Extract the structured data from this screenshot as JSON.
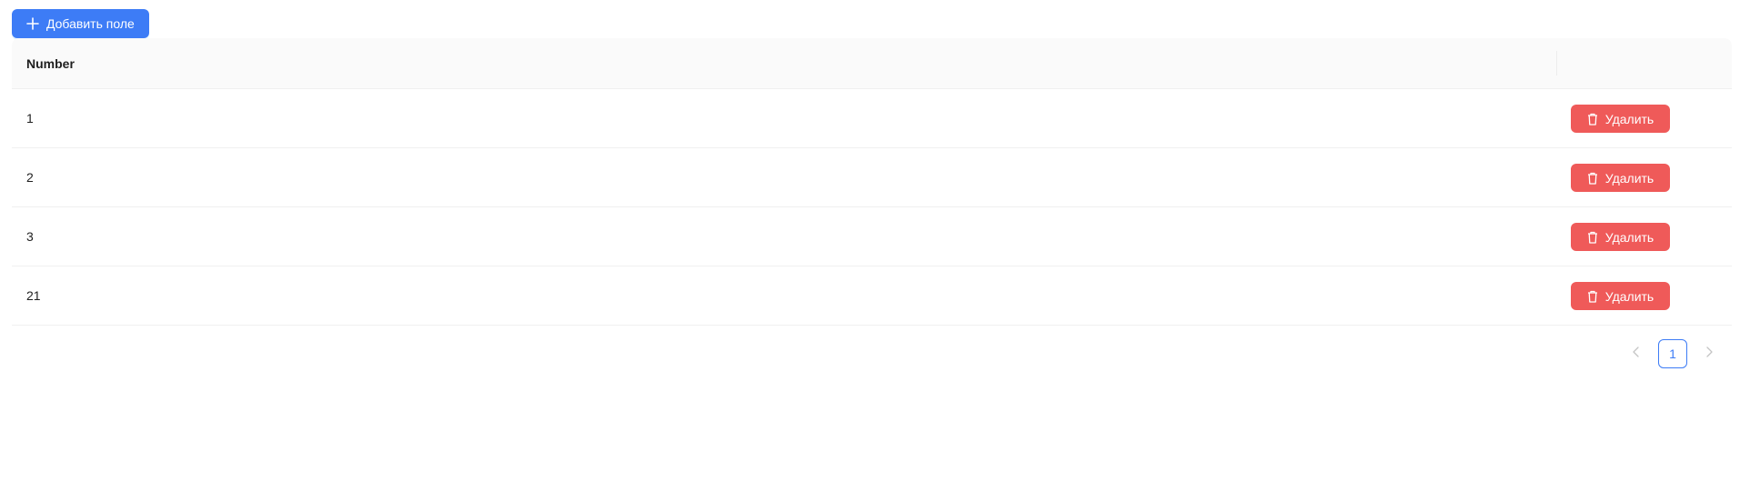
{
  "toolbar": {
    "add_label": "Добавить поле",
    "add_icon": "plus-icon"
  },
  "table": {
    "columns": [
      "Number",
      ""
    ],
    "rows": [
      {
        "number": "1",
        "delete_label": "Удалить"
      },
      {
        "number": "2",
        "delete_label": "Удалить"
      },
      {
        "number": "3",
        "delete_label": "Удалить"
      },
      {
        "number": "21",
        "delete_label": "Удалить"
      }
    ],
    "delete_icon": "trash-icon"
  },
  "pagination": {
    "current_page": "1",
    "prev_icon": "chevron-left-icon",
    "next_icon": "chevron-right-icon"
  },
  "colors": {
    "primary": "#3d7cf6",
    "danger": "#ef5a59",
    "header_bg": "#fafafa",
    "border": "#f0f0f0"
  }
}
